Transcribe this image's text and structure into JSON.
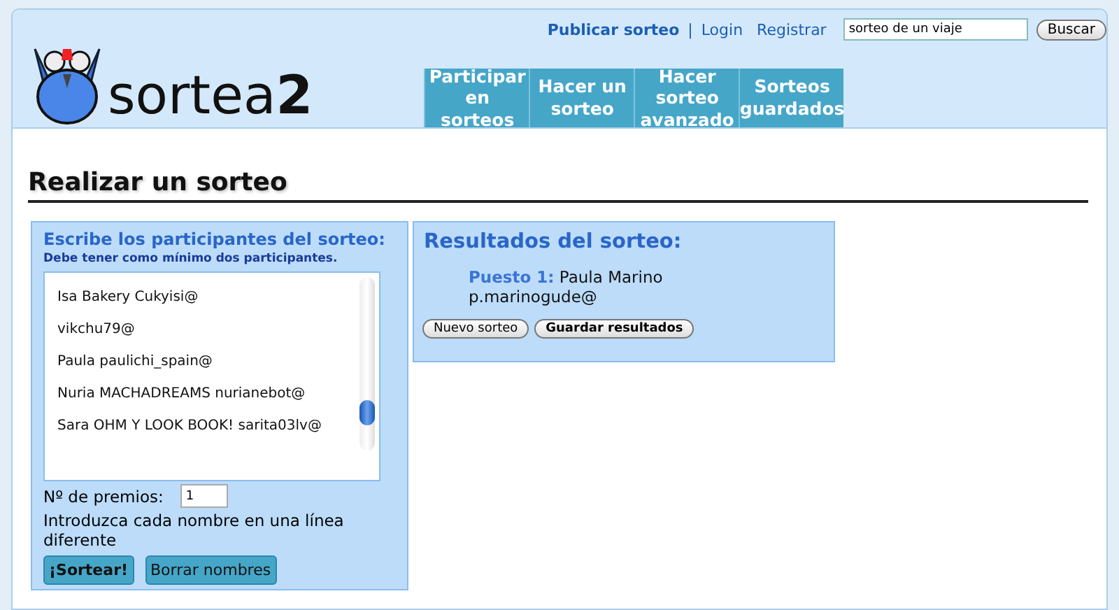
{
  "header": {
    "logo_text": "sortea",
    "logo_digit": "2",
    "top_links": [
      {
        "label": "Publicar sorteo",
        "kind": "strong"
      },
      {
        "label": "|",
        "kind": "sep"
      },
      {
        "label": "Login",
        "kind": "link"
      },
      {
        "label": "Registrar",
        "kind": "link"
      }
    ],
    "search": {
      "value": "sorteo de un viaje",
      "button": "Buscar"
    },
    "nav": [
      {
        "label": "Participar en sorteos"
      },
      {
        "label": "Hacer un sorteo"
      },
      {
        "label": "Hacer sorteo avanzado"
      },
      {
        "label": "Sorteos guardados"
      }
    ]
  },
  "page_title": "Realizar un sorteo",
  "participants_panel": {
    "title": "Escribe los participantes del sorteo:",
    "hint": "Debe tener como mínimo dos participantes.",
    "entries": [
      "Isa Bakery Cukyisi@",
      "vikchu79@",
      "Paula paulichi_spain@",
      "Nuria MACHADREAMS nurianebot@",
      "Sara OHM Y LOOK BOOK! sarita03lv@"
    ],
    "prizes_label": "Nº de premios:",
    "prizes_value": "1",
    "instructions": "Introduzca cada nombre en una línea diferente",
    "buttons": [
      {
        "label": "¡Sortear!",
        "kind": "primary"
      },
      {
        "label": "Borrar nombres",
        "kind": "secondary"
      }
    ]
  },
  "results_panel": {
    "title": "Resultados del sorteo:",
    "results": [
      {
        "place": "Puesto 1:",
        "name": "Paula Marino",
        "email": "p.marinogude@"
      }
    ],
    "buttons": [
      "Nuevo sorteo",
      "Guardar resultados"
    ]
  }
}
